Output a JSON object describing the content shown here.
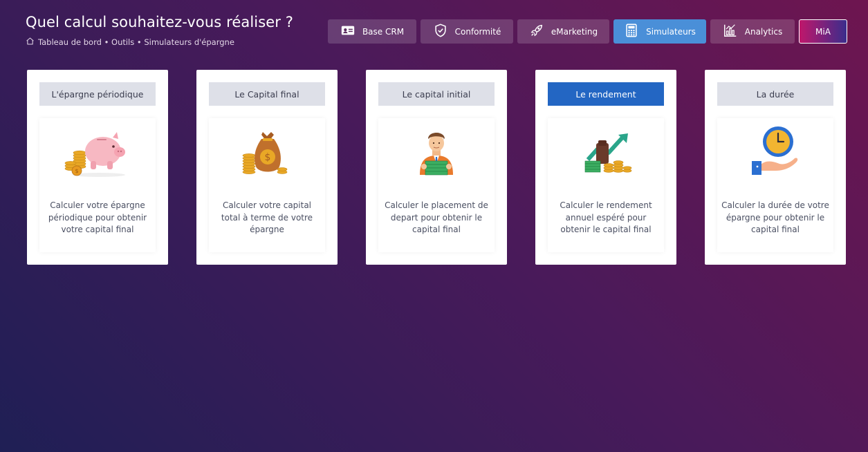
{
  "header": {
    "title": "Quel calcul souhaitez-vous réaliser ?",
    "breadcrumb": "Tableau de bord • Outils • Simulateurs d'épargne"
  },
  "nav": [
    {
      "label": "Base CRM",
      "icon": "id-card-icon"
    },
    {
      "label": "Conformité",
      "icon": "shield-check-icon"
    },
    {
      "label": "eMarketing",
      "icon": "rocket-icon"
    },
    {
      "label": "Simulateurs",
      "icon": "calculator-icon",
      "active": true
    },
    {
      "label": "Analytics",
      "icon": "chart-icon"
    },
    {
      "label": "MiA"
    }
  ],
  "cards": [
    {
      "button": "L'épargne périodique",
      "description": "Calculer votre épargne périodique pour obtenir votre capital final",
      "icon": "piggy-bank-icon"
    },
    {
      "button": "Le Capital final",
      "description": "Calculer votre capital total à terme de votre épargne",
      "icon": "money-bag-icon"
    },
    {
      "button": "Le capital initial",
      "description": "Calculer le placement de depart pour obtenir le capital final",
      "icon": "man-with-money-icon"
    },
    {
      "button": "Le rendement",
      "description": "Calculer le rendement annuel espéré pour obtenir le capital final",
      "icon": "growth-chart-icon",
      "active": true
    },
    {
      "button": "La durée",
      "description": "Calculer la durée de votre épargne pour obtenir le capital final",
      "icon": "clock-hand-icon"
    }
  ],
  "colors": {
    "active_nav": "#4a8fd8",
    "active_card_button": "#2366c3",
    "card_button": "#dee0e8"
  }
}
